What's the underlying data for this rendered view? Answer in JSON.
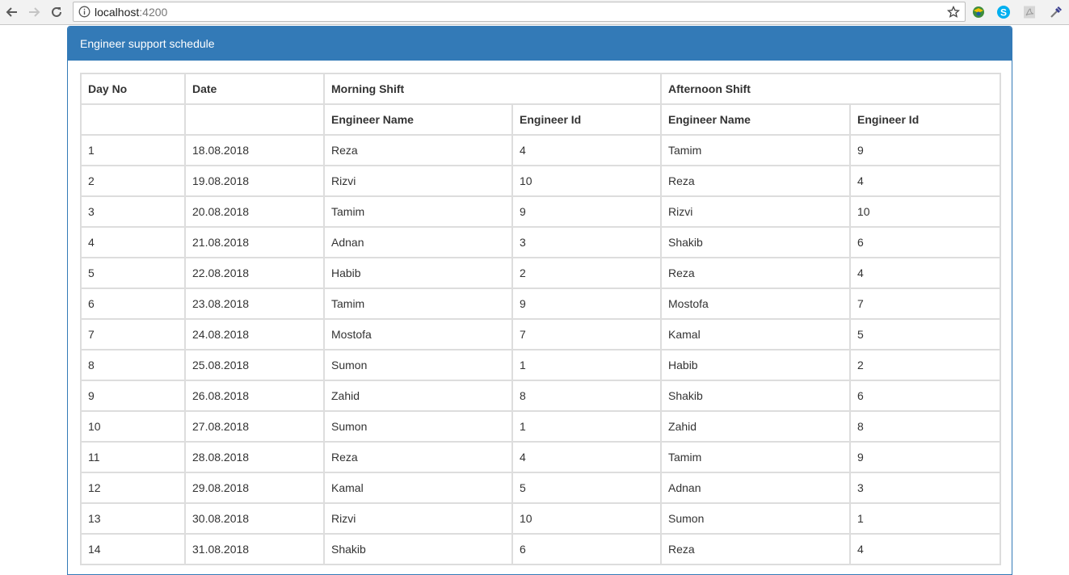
{
  "browser": {
    "url_host": "localhost",
    "url_port": ":4200"
  },
  "panel": {
    "title": "Engineer support schedule"
  },
  "table": {
    "header1": [
      "Day No",
      "Date",
      "Morning Shift",
      "Afternoon Shift"
    ],
    "header2": [
      "",
      "",
      "Engineer Name",
      "Engineer Id",
      "Engineer Name",
      "Engineer Id"
    ],
    "rows": [
      [
        "1",
        "18.08.2018",
        "Reza",
        "4",
        "Tamim",
        "9"
      ],
      [
        "2",
        "19.08.2018",
        "Rizvi",
        "10",
        "Reza",
        "4"
      ],
      [
        "3",
        "20.08.2018",
        "Tamim",
        "9",
        "Rizvi",
        "10"
      ],
      [
        "4",
        "21.08.2018",
        "Adnan",
        "3",
        "Shakib",
        "6"
      ],
      [
        "5",
        "22.08.2018",
        "Habib",
        "2",
        "Reza",
        "4"
      ],
      [
        "6",
        "23.08.2018",
        "Tamim",
        "9",
        "Mostofa",
        "7"
      ],
      [
        "7",
        "24.08.2018",
        "Mostofa",
        "7",
        "Kamal",
        "5"
      ],
      [
        "8",
        "25.08.2018",
        "Sumon",
        "1",
        "Habib",
        "2"
      ],
      [
        "9",
        "26.08.2018",
        "Zahid",
        "8",
        "Shakib",
        "6"
      ],
      [
        "10",
        "27.08.2018",
        "Sumon",
        "1",
        "Zahid",
        "8"
      ],
      [
        "11",
        "28.08.2018",
        "Reza",
        "4",
        "Tamim",
        "9"
      ],
      [
        "12",
        "29.08.2018",
        "Kamal",
        "5",
        "Adnan",
        "3"
      ],
      [
        "13",
        "30.08.2018",
        "Rizvi",
        "10",
        "Sumon",
        "1"
      ],
      [
        "14",
        "31.08.2018",
        "Shakib",
        "6",
        "Reza",
        "4"
      ]
    ]
  },
  "colors": {
    "panel_primary": "#337ab7",
    "table_border": "#dddddd"
  },
  "icons": {
    "back": "back-arrow-icon",
    "forward": "forward-arrow-icon",
    "reload": "reload-icon",
    "info": "info-icon",
    "star": "bookmark-star-icon",
    "ext1": "extension-icon",
    "ext2": "skype-icon",
    "ext3": "pdf-icon",
    "ext4": "eyedropper-icon"
  }
}
